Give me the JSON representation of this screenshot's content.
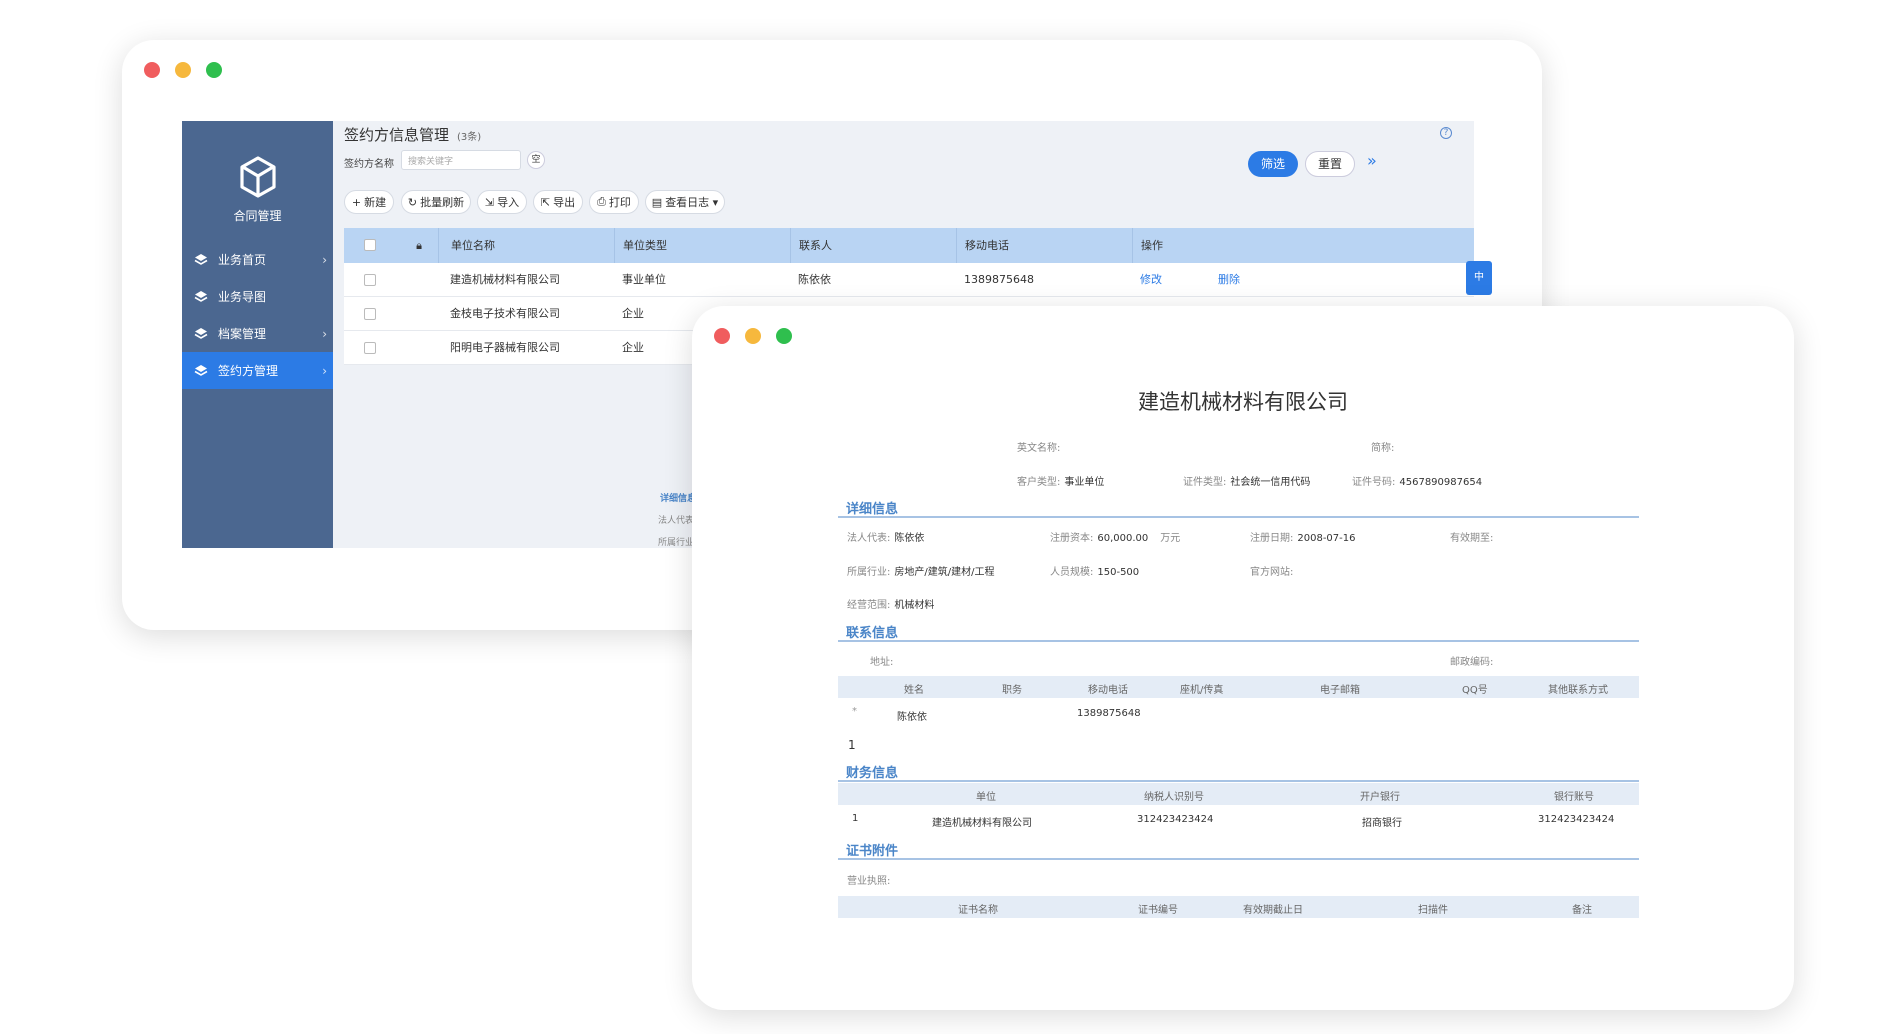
{
  "colors": {
    "red_dot": "#f05d5e",
    "yellow_dot": "#f6b83d",
    "green_dot": "#2fbf4e",
    "sidebar": "#4b6790",
    "accent": "#2c7be5",
    "table_header": "#b9d4f3"
  },
  "sidebar": {
    "title": "合同管理",
    "items": [
      {
        "label": "业务首页",
        "icon": "layers-icon"
      },
      {
        "label": "业务导图",
        "icon": "layers-icon"
      },
      {
        "label": "档案管理",
        "icon": "layers-icon"
      },
      {
        "label": "签约方管理",
        "icon": "layers-icon",
        "active": true
      }
    ]
  },
  "header": {
    "title": "签约方信息管理",
    "count": "(3条)",
    "help": "?"
  },
  "filter": {
    "label": "签约方名称",
    "placeholder": "搜索关键字",
    "clear": "空",
    "apply": "筛选",
    "reset": "重置",
    "more": "»"
  },
  "toolbar": [
    {
      "icon": "+",
      "label": "新建"
    },
    {
      "icon": "↻",
      "label": "批量刷新"
    },
    {
      "icon": "⇲",
      "label": "导入"
    },
    {
      "icon": "⇱",
      "label": "导出"
    },
    {
      "icon": "⎙",
      "label": "打印"
    },
    {
      "icon": "▤",
      "label": "查看日志 ▾"
    }
  ],
  "table": {
    "columns": [
      "单位名称",
      "单位类型",
      "联系人",
      "移动电话",
      "操作"
    ],
    "rows": [
      {
        "name": "建造机械材料有限公司",
        "type": "事业单位",
        "contact": "陈依依",
        "phone": "1389875648",
        "edit": "修改",
        "delete": "删除"
      },
      {
        "name": "金枝电子技术有限公司",
        "type": "企业",
        "contact": "",
        "phone": ""
      },
      {
        "name": "阳明电子器械有限公司",
        "type": "企业",
        "contact": "",
        "phone": ""
      }
    ],
    "side_button": "中"
  },
  "peek": {
    "section": "详细信息",
    "rep": "法人代表:",
    "industry": "所属行业:"
  },
  "detail": {
    "company": "建造机械材料有限公司",
    "en_name_label": "英文名称:",
    "short_label": "简称:",
    "customer_type_label": "客户类型:",
    "customer_type": "事业单位",
    "id_type_label": "证件类型:",
    "id_type": "社会统一信用代码",
    "id_no_label": "证件号码:",
    "id_no": "4567890987654",
    "sections": {
      "detail": "详细信息",
      "contact": "联系信息",
      "finance": "财务信息",
      "cert": "证书附件"
    },
    "rep_label": "法人代表:",
    "rep": "陈依依",
    "capital_label": "注册资本:",
    "capital": "60,000.00",
    "capital_unit": "万元",
    "reg_date_label": "注册日期:",
    "reg_date": "2008-07-16",
    "valid_label": "有效期至:",
    "industry_label": "所属行业:",
    "industry": "房地产/建筑/建材/工程",
    "size_label": "人员规模:",
    "size": "150-500",
    "site_label": "官方网站:",
    "scope_label": "经营范围:",
    "scope": "机械材料",
    "address_label": "地址:",
    "zip_label": "邮政编码:",
    "contact_cols": [
      "姓名",
      "职务",
      "移动电话",
      "座机/传真",
      "电子邮箱",
      "QQ号",
      "其他联系方式"
    ],
    "contact_row": {
      "mark": "*",
      "name": "陈依依",
      "phone": "1389875648"
    },
    "contact_count": "1",
    "finance_cols": [
      "单位",
      "纳税人识别号",
      "开户银行",
      "银行账号"
    ],
    "finance_row": {
      "idx": "1",
      "unit": "建造机械材料有限公司",
      "tax": "312423423424",
      "bank": "招商银行",
      "account": "312423423424"
    },
    "license_label": "营业执照:",
    "cert_cols": [
      "证书名称",
      "证书编号",
      "有效期截止日",
      "扫描件",
      "备注"
    ]
  }
}
